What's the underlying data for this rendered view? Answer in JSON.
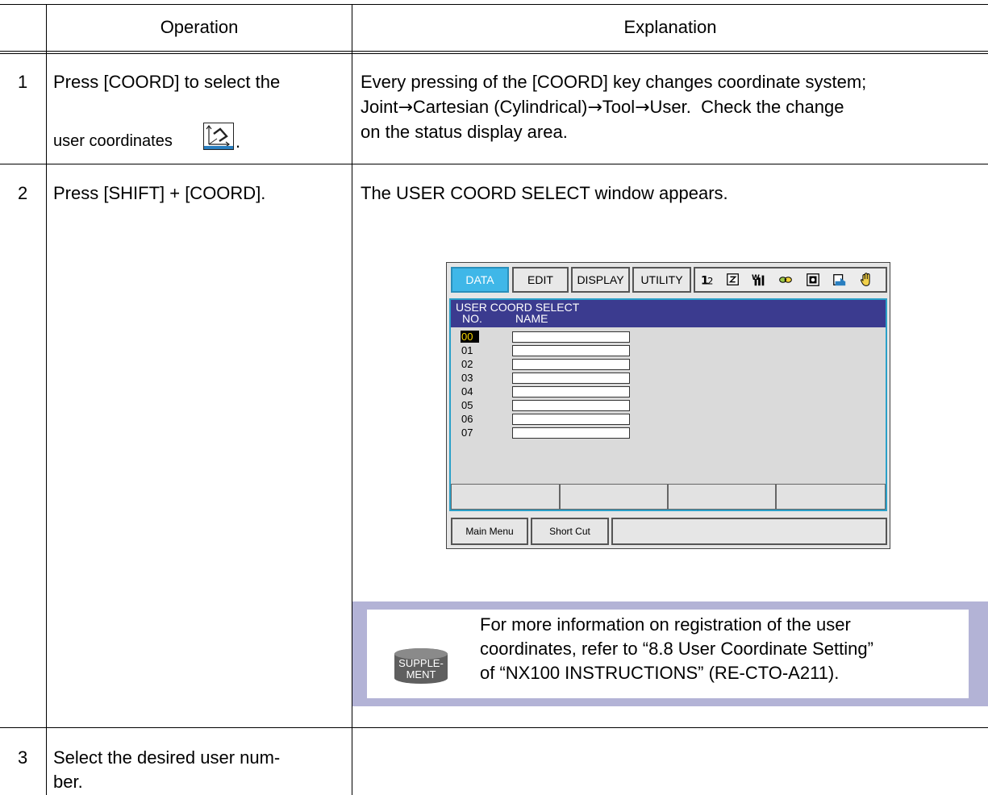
{
  "table": {
    "headers": {
      "operation": "Operation",
      "explanation": "Explanation"
    },
    "rows": [
      {
        "num": "1",
        "op_line1": "Press [COORD] to select the",
        "op_line2": "user coordinates",
        "op_trailing": ".",
        "op_icon": "user-coord-icon",
        "ex_line1": "Every pressing of the [COORD] key changes coordinate system;",
        "ex_seq": [
          "Joint",
          "Cartesian (Cylindrical)",
          "Tool",
          "User."
        ],
        "ex_line2_tail": "Check the change",
        "ex_line3": "on the status display area."
      },
      {
        "num": "2",
        "op_line1": "Press [SHIFT] + [COORD].",
        "ex_line1": "The USER COORD SELECT window appears."
      },
      {
        "num": "3",
        "op_line1": "Select the desired user num-",
        "op_line2": "ber."
      }
    ]
  },
  "pendant": {
    "menu_tabs": [
      "DATA",
      "EDIT",
      "DISPLAY",
      "UTILITY"
    ],
    "active_tab": "DATA",
    "status_icons": [
      "numbering-icon",
      "step-icon",
      "mode-icon",
      "link-icon",
      "servo-icon",
      "cycle-icon",
      "hand-icon"
    ],
    "title": "USER COORD SELECT",
    "col_no": "NO.",
    "col_name": "NAME",
    "rows": [
      "00",
      "01",
      "02",
      "03",
      "04",
      "05",
      "06",
      "07"
    ],
    "selected_row": "00",
    "bottom_buttons": [
      "Main Menu",
      "Short Cut"
    ],
    "colors": {
      "active_tab": "#3fb7e8",
      "title_bar": "#3b3b8f",
      "selection_text": "#f5d400",
      "screen_border": "#2aa0c8"
    }
  },
  "supplement": {
    "badge_line1": "SUPPLE-",
    "badge_line2": "MENT",
    "text_line1": "For more information on registration of the user",
    "text_line2": "coordinates, refer to “8.8 User Coordinate Setting”",
    "text_line3": "of “NX100 INSTRUCTIONS” (RE-CTO-A211).",
    "frame_color": "#b3b3d6"
  }
}
